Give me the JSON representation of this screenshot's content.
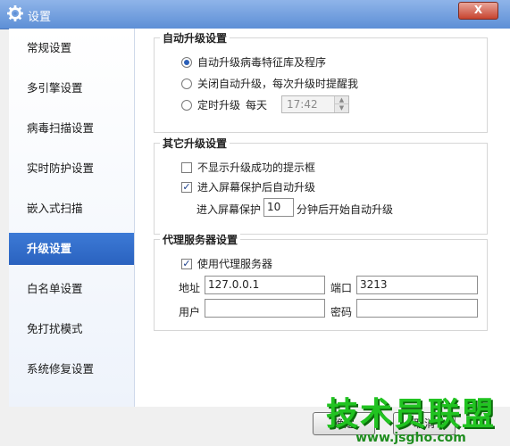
{
  "window": {
    "title": "设置",
    "close_label": "X"
  },
  "sidebar": {
    "items": [
      {
        "label": "常规设置"
      },
      {
        "label": "多引擎设置"
      },
      {
        "label": "病毒扫描设置"
      },
      {
        "label": "实时防护设置"
      },
      {
        "label": "嵌入式扫描"
      },
      {
        "label": "升级设置",
        "active": true
      },
      {
        "label": "白名单设置"
      },
      {
        "label": "免打扰模式"
      },
      {
        "label": "系统修复设置"
      }
    ]
  },
  "auto_upgrade": {
    "title": "自动升级设置",
    "opt1": "自动升级病毒特征库及程序",
    "opt2": "关闭自动升级，每次升级时提醒我",
    "opt3": "定时升级",
    "daily": "每天",
    "time_value": "17:42",
    "selected": "opt1"
  },
  "other_upgrade": {
    "title": "其它升级设置",
    "no_popup": "不显示升级成功的提示框",
    "screensaver_upgrade": "进入屏幕保护后自动升级",
    "screensaver_prefix": "进入屏幕保护",
    "minutes_value": "10",
    "screensaver_suffix": "分钟后开始自动升级"
  },
  "proxy": {
    "title": "代理服务器设置",
    "use_proxy": "使用代理服务器",
    "address_label": "地址",
    "address_value": "127.0.0.1",
    "port_label": "端口",
    "port_value": "3213",
    "user_label": "用户",
    "user_value": "",
    "password_label": "密码",
    "password_value": ""
  },
  "footer": {
    "ok_label": "确定",
    "cancel_label": "取消"
  },
  "watermark": {
    "brand": "技术员联盟",
    "url": "www.jsgho.com"
  }
}
